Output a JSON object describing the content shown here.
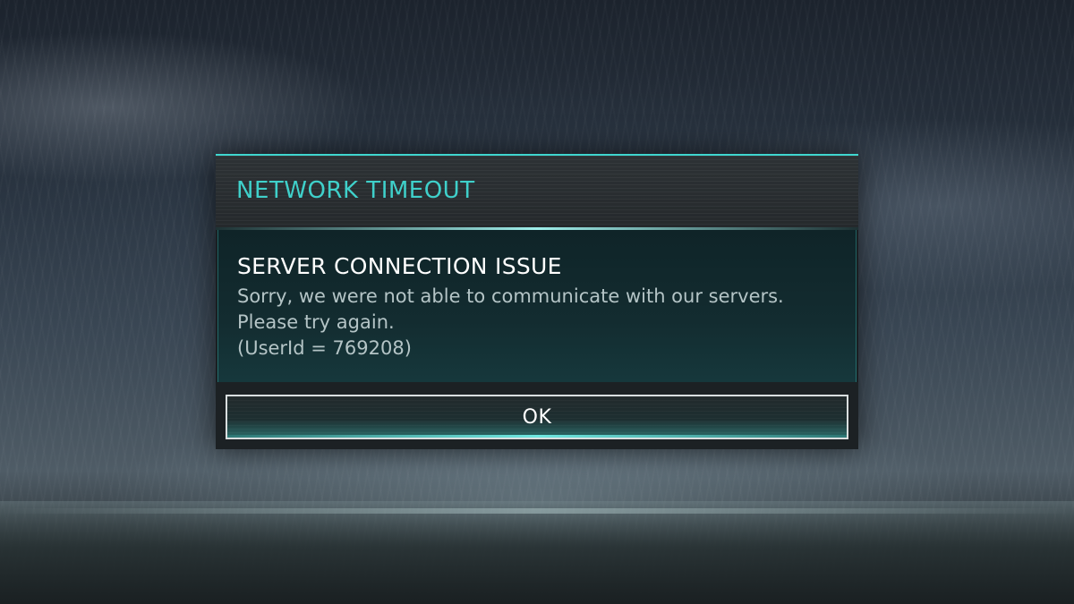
{
  "dialog": {
    "title": "NETWORK TIMEOUT",
    "heading": "SERVER CONNECTION ISSUE",
    "message": "Sorry, we were not able to communicate with our servers. Please try again.",
    "user_id_line": "(UserId = 769208)",
    "ok_label": "OK"
  },
  "colors": {
    "accent": "#3fd0ca",
    "heading_text": "#ffffff",
    "message_text": "#b4c4c6",
    "panel_dark": "#1a1f22",
    "body_teal": "#132c30"
  },
  "icons": []
}
